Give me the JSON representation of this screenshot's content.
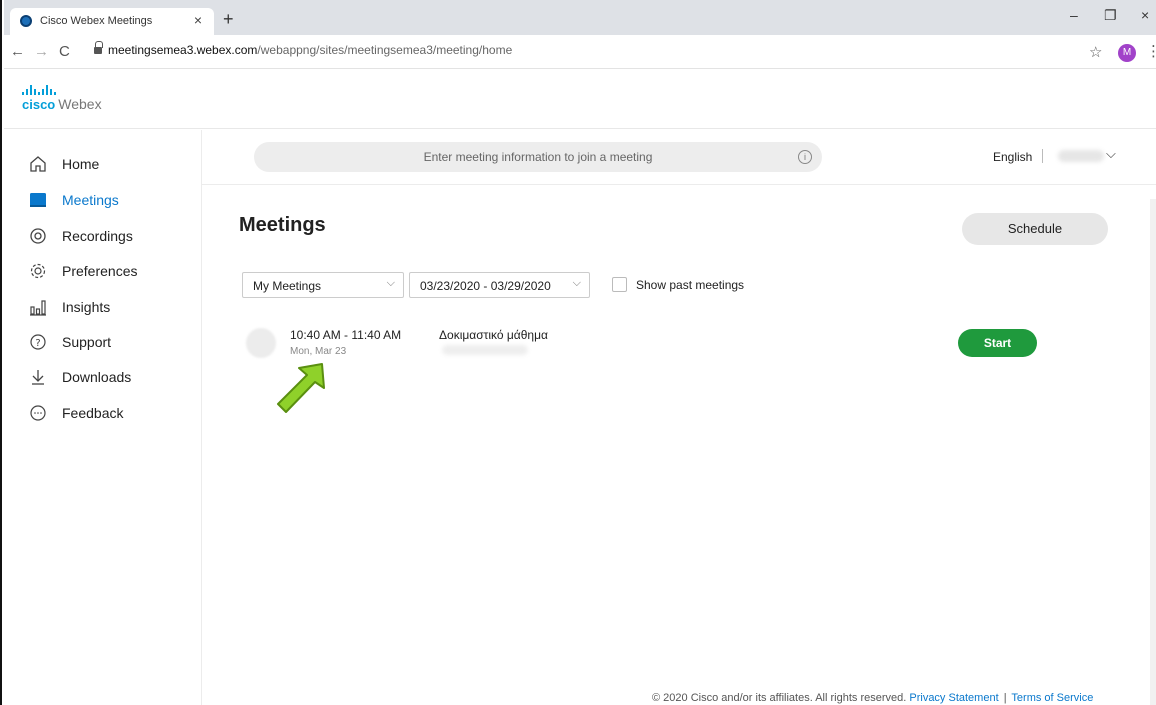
{
  "browser": {
    "tab_title": "Cisco Webex Meetings",
    "tab_close": "×",
    "new_tab": "+",
    "url_host": "meetingsemea3.webex.com",
    "url_path": "/webappng/sites/meetingsemea3/meeting/home",
    "profile_initial": "M",
    "window_controls": {
      "minimize": "–",
      "restore": "❐",
      "close": "×"
    },
    "nav": {
      "back": "←",
      "forward": "→",
      "reload": "C"
    },
    "star": "☆",
    "menu": "⋮"
  },
  "app": {
    "logo_cisco": "cisco",
    "logo_webex": "Webex"
  },
  "sidebar": {
    "items": [
      {
        "label": "Home",
        "icon": "home-icon"
      },
      {
        "label": "Meetings",
        "icon": "calendar-icon",
        "active": true
      },
      {
        "label": "Recordings",
        "icon": "record-icon"
      },
      {
        "label": "Preferences",
        "icon": "gear-icon"
      },
      {
        "label": "Insights",
        "icon": "insights-icon"
      },
      {
        "label": "Support",
        "icon": "help-icon"
      },
      {
        "label": "Downloads",
        "icon": "download-icon"
      },
      {
        "label": "Feedback",
        "icon": "feedback-icon"
      }
    ]
  },
  "header": {
    "join_placeholder": "Enter meeting information to join a meeting",
    "info_glyph": "i",
    "language": "English",
    "user_chevron": "⌵"
  },
  "main": {
    "title": "Meetings",
    "schedule_label": "Schedule",
    "filter_value": "My Meetings",
    "date_range": "03/23/2020 - 03/29/2020",
    "chevron": "⌵",
    "show_past_label": "Show past meetings",
    "meetings": [
      {
        "time": "10:40 AM - 11:40 AM",
        "date": "Mon, Mar 23",
        "title": "Δοκιμαστικό μάθημα",
        "action": "Start"
      }
    ]
  },
  "footer": {
    "copyright": "© 2020 Cisco and/or its affiliates. All rights reserved.",
    "privacy": "Privacy Statement",
    "separator": "|",
    "terms": "Terms of Service"
  },
  "colors": {
    "accent": "#0a78cc",
    "start_button": "#1f9a3d",
    "brand": "#049fd9",
    "arrow": "#8fd12a"
  }
}
